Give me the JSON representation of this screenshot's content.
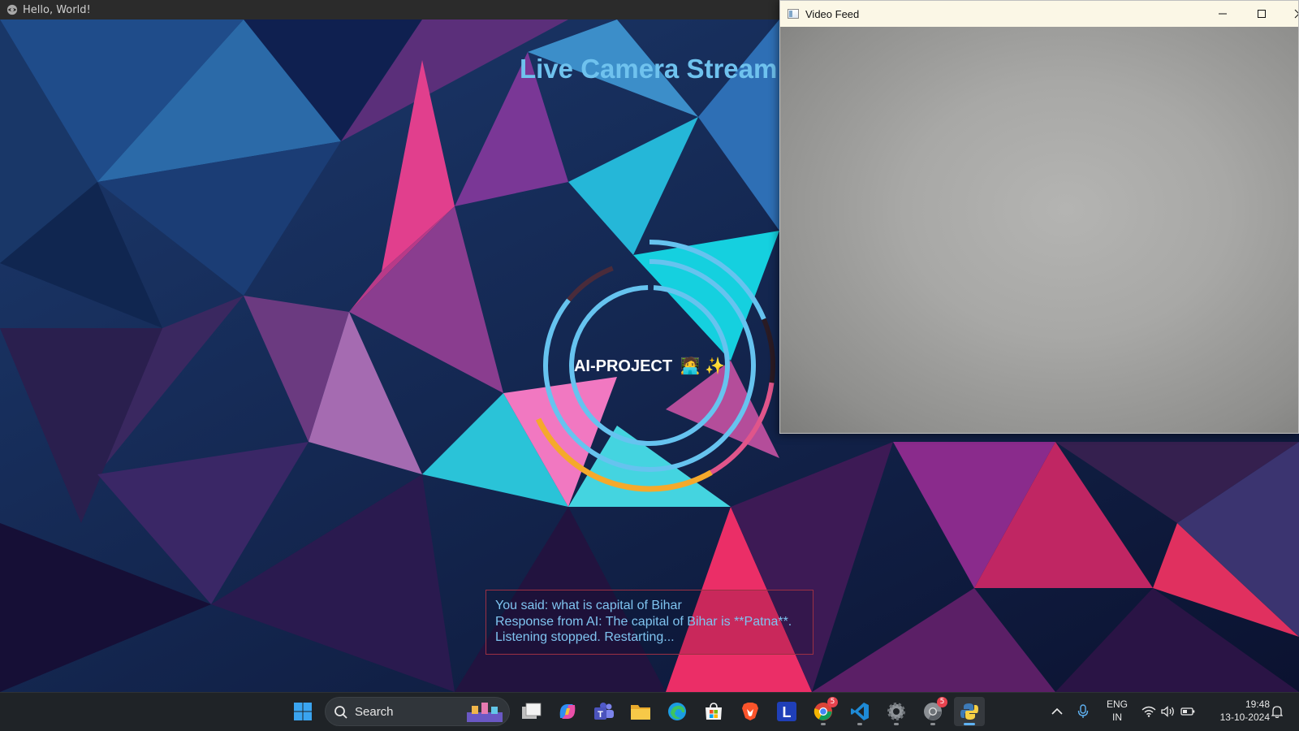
{
  "app_window": {
    "title": "Hello, World!"
  },
  "main": {
    "heading": "Live Camera Stream",
    "ai_label": "AI-PROJECT",
    "ai_emoji": "🧑‍💻 ✨",
    "log_lines": [
      "You said: what is capital of Bihar",
      "Response from AI: The capital of Bihar is **Patna**.",
      "Listening stopped. Restarting..."
    ]
  },
  "video_window": {
    "title": "Video Feed",
    "controls": [
      "minimize-icon",
      "maximize-icon",
      "close-icon"
    ]
  },
  "taskbar": {
    "search_placeholder": "Search",
    "apps": [
      {
        "name": "windows-start-icon"
      },
      {
        "name": "search-icon"
      },
      {
        "name": "task-view-icon"
      },
      {
        "name": "copilot-icon"
      },
      {
        "name": "teams-icon"
      },
      {
        "name": "file-explorer-icon"
      },
      {
        "name": "edge-icon"
      },
      {
        "name": "microsoft-store-icon"
      },
      {
        "name": "brave-icon"
      },
      {
        "name": "l-app-icon",
        "label": "L"
      },
      {
        "name": "chrome-icon",
        "badge": "5"
      },
      {
        "name": "vscode-icon"
      },
      {
        "name": "settings-icon"
      },
      {
        "name": "chrome-profile-icon",
        "badge": "5"
      },
      {
        "name": "python-icon",
        "active": true
      }
    ],
    "tray": {
      "chevron": "chevron-up-icon",
      "mic": "microphone-icon",
      "language": "ENG",
      "region": "IN",
      "wifi": "wifi-icon",
      "volume": "volume-icon",
      "battery": "battery-icon",
      "time": "19:48",
      "date": "13-10-2024",
      "notifications": "notification-bell-icon"
    }
  },
  "colors": {
    "heading": "#6fc2ee",
    "ring_blue": "#66c3ef",
    "ring_orange": "#f5a92b",
    "ring_pink": "#e0558a",
    "log_text": "#7fc4f0",
    "log_border": "#9b3043",
    "taskbar_bg": "#1f2327",
    "active_indicator": "#5fb2f2"
  }
}
